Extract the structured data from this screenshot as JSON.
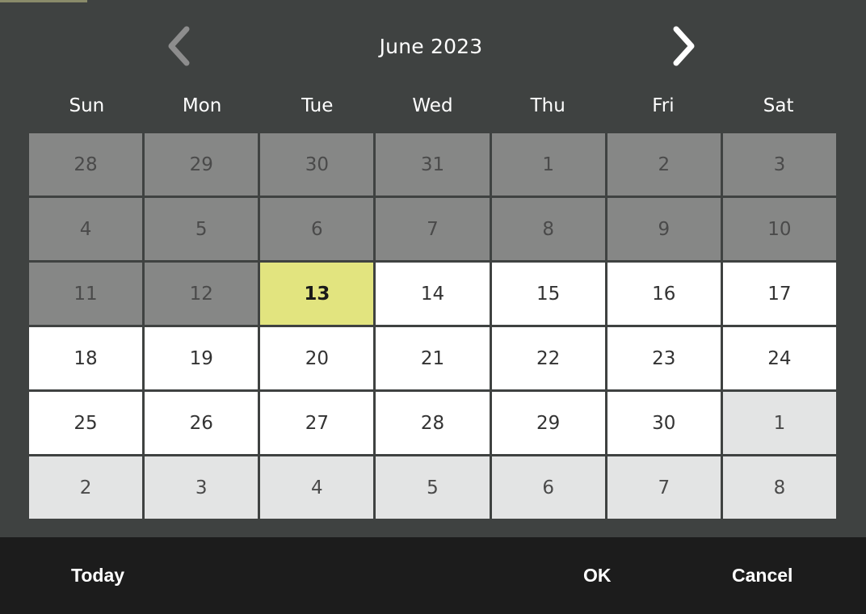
{
  "dialog": {
    "type": "date-picker",
    "accent_selected_bg": "#e2e47f",
    "background": "#3f4241",
    "footer_background": "#1c1c1c"
  },
  "header": {
    "title": "June 2023",
    "prev_icon": "chevron-left-icon",
    "next_icon": "chevron-right-icon",
    "prev_enabled": false,
    "next_enabled": true,
    "prev_color": "#8d8d8d",
    "next_color": "#ffffff"
  },
  "weekdays": [
    "Sun",
    "Mon",
    "Tue",
    "Wed",
    "Thu",
    "Fri",
    "Sat"
  ],
  "days": [
    {
      "label": "28",
      "state": "past"
    },
    {
      "label": "29",
      "state": "past"
    },
    {
      "label": "30",
      "state": "past"
    },
    {
      "label": "31",
      "state": "past"
    },
    {
      "label": "1",
      "state": "past"
    },
    {
      "label": "2",
      "state": "past"
    },
    {
      "label": "3",
      "state": "past"
    },
    {
      "label": "4",
      "state": "past"
    },
    {
      "label": "5",
      "state": "past"
    },
    {
      "label": "6",
      "state": "past"
    },
    {
      "label": "7",
      "state": "past"
    },
    {
      "label": "8",
      "state": "past"
    },
    {
      "label": "9",
      "state": "past"
    },
    {
      "label": "10",
      "state": "past"
    },
    {
      "label": "11",
      "state": "past"
    },
    {
      "label": "12",
      "state": "past"
    },
    {
      "label": "13",
      "state": "selected"
    },
    {
      "label": "14",
      "state": "current"
    },
    {
      "label": "15",
      "state": "current"
    },
    {
      "label": "16",
      "state": "current"
    },
    {
      "label": "17",
      "state": "current"
    },
    {
      "label": "18",
      "state": "current"
    },
    {
      "label": "19",
      "state": "current"
    },
    {
      "label": "20",
      "state": "current"
    },
    {
      "label": "21",
      "state": "current"
    },
    {
      "label": "22",
      "state": "current"
    },
    {
      "label": "23",
      "state": "current"
    },
    {
      "label": "24",
      "state": "current"
    },
    {
      "label": "25",
      "state": "current"
    },
    {
      "label": "26",
      "state": "current"
    },
    {
      "label": "27",
      "state": "current"
    },
    {
      "label": "28",
      "state": "current"
    },
    {
      "label": "29",
      "state": "current"
    },
    {
      "label": "30",
      "state": "current"
    },
    {
      "label": "1",
      "state": "next"
    },
    {
      "label": "2",
      "state": "next"
    },
    {
      "label": "3",
      "state": "next"
    },
    {
      "label": "4",
      "state": "next"
    },
    {
      "label": "5",
      "state": "next"
    },
    {
      "label": "6",
      "state": "next"
    },
    {
      "label": "7",
      "state": "next"
    },
    {
      "label": "8",
      "state": "next"
    }
  ],
  "selected_day": "13",
  "footer": {
    "today_label": "Today",
    "ok_label": "OK",
    "cancel_label": "Cancel"
  }
}
